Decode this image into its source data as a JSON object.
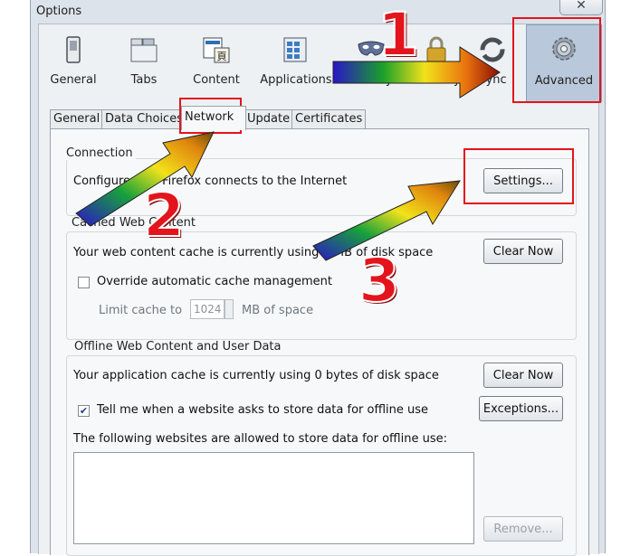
{
  "window": {
    "title": "Options",
    "close_glyph": "✕"
  },
  "categories": [
    {
      "label": "General",
      "icon": "general-switch-icon",
      "active": false
    },
    {
      "label": "Tabs",
      "icon": "tabs-icon",
      "active": false
    },
    {
      "label": "Content",
      "icon": "content-icon",
      "active": false
    },
    {
      "label": "Applications",
      "icon": "applications-icon",
      "active": false
    },
    {
      "label": "Privacy",
      "icon": "privacy-mask-icon",
      "active": false
    },
    {
      "label": "Security",
      "icon": "security-lock-icon",
      "active": false
    },
    {
      "label": "Sync",
      "icon": "sync-icon",
      "active": false
    },
    {
      "label": "Advanced",
      "icon": "advanced-gear-icon",
      "active": true
    }
  ],
  "tabs": [
    {
      "label": "General",
      "active": false
    },
    {
      "label": "Data Choices",
      "active": false
    },
    {
      "label": "Network",
      "active": true
    },
    {
      "label": "Update",
      "active": false
    },
    {
      "label": "Certificates",
      "active": false
    }
  ],
  "connection": {
    "title": "Connection",
    "description": "Configure how Firefox connects to the Internet",
    "settings_button": "Settings..."
  },
  "cache": {
    "title": "Cached Web Content",
    "usage_text": "Your web content cache is currently using 0 MB of disk space",
    "clear_button": "Clear Now",
    "override_label": "Override automatic cache management",
    "override_checked": false,
    "limit_label": "Limit cache to",
    "limit_value": "1024",
    "limit_unit": "MB of space"
  },
  "offline": {
    "title": "Offline Web Content and User Data",
    "usage_text": "Your application cache is currently using 0 bytes of disk space",
    "clear_button": "Clear Now",
    "tell_me_label": "Tell me when a website asks to store data for offline use",
    "tell_me_checked": true,
    "exceptions_button": "Exceptions...",
    "allowed_label": "The following websites are allowed to store data for offline use:",
    "allowed_sites": [],
    "remove_button": "Remove..."
  },
  "annotations": {
    "step_1": "1",
    "step_2": "2",
    "step_3": "3",
    "highlight_color": "#e3141c"
  }
}
